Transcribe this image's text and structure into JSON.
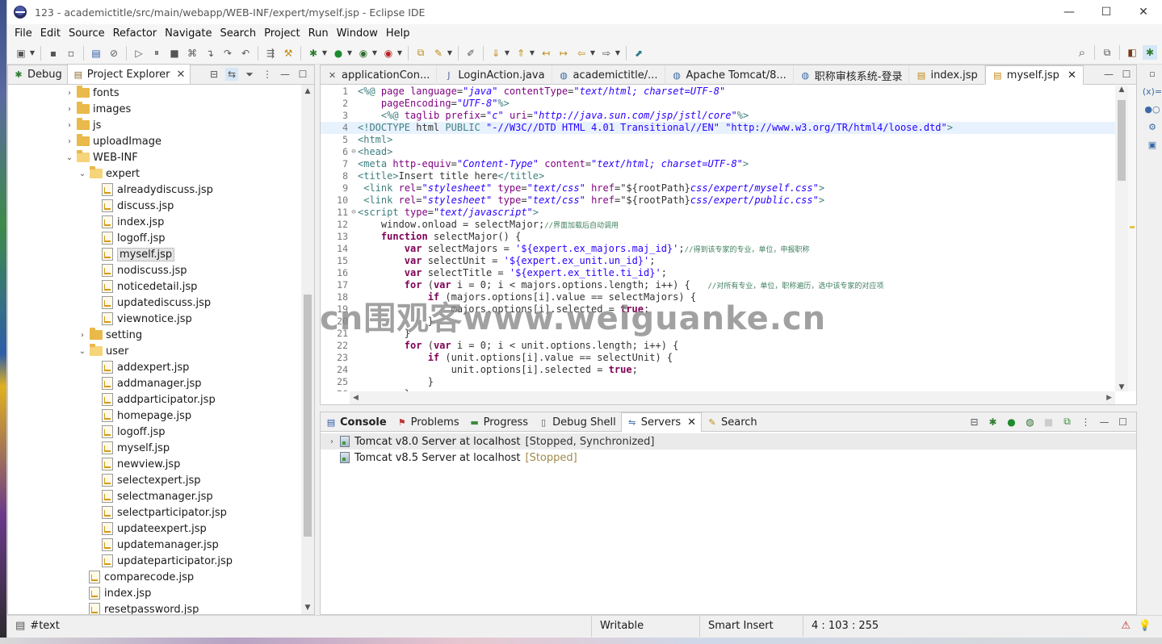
{
  "window": {
    "title": "123 - academictitle/src/main/webapp/WEB-INF/expert/myself.jsp - Eclipse IDE",
    "controls": [
      "—",
      "☐",
      "✕"
    ]
  },
  "menu": [
    "File",
    "Edit",
    "Source",
    "Refactor",
    "Navigate",
    "Search",
    "Project",
    "Run",
    "Window",
    "Help"
  ],
  "left_panel": {
    "tabs": [
      {
        "label": "Debug",
        "icon": "debug-icon"
      },
      {
        "label": "Project Explorer",
        "icon": "project-explorer-icon",
        "close": "✕"
      }
    ],
    "tree": [
      {
        "label": "fonts",
        "type": "folder",
        "depth": 0,
        "chevron": "›"
      },
      {
        "label": "images",
        "type": "folder",
        "depth": 0,
        "chevron": "›"
      },
      {
        "label": "js",
        "type": "folder",
        "depth": 0,
        "chevron": "›"
      },
      {
        "label": "uploadImage",
        "type": "folder",
        "depth": 0,
        "chevron": "›"
      },
      {
        "label": "WEB-INF",
        "type": "folder-open",
        "depth": 0,
        "chevron": "⌄"
      },
      {
        "label": "expert",
        "type": "folder-open",
        "depth": 1,
        "chevron": "⌄"
      },
      {
        "label": "alreadydiscuss.jsp",
        "type": "file",
        "depth": 2
      },
      {
        "label": "discuss.jsp",
        "type": "file",
        "depth": 2
      },
      {
        "label": "index.jsp",
        "type": "file",
        "depth": 2
      },
      {
        "label": "logoff.jsp",
        "type": "file",
        "depth": 2
      },
      {
        "label": "myself.jsp",
        "type": "file",
        "depth": 2,
        "selected": true
      },
      {
        "label": "nodiscuss.jsp",
        "type": "file",
        "depth": 2
      },
      {
        "label": "noticedetail.jsp",
        "type": "file",
        "depth": 2
      },
      {
        "label": "updatediscuss.jsp",
        "type": "file",
        "depth": 2
      },
      {
        "label": "viewnotice.jsp",
        "type": "file",
        "depth": 2
      },
      {
        "label": "setting",
        "type": "folder",
        "depth": 1,
        "chevron": "›"
      },
      {
        "label": "user",
        "type": "folder-open",
        "depth": 1,
        "chevron": "⌄"
      },
      {
        "label": "addexpert.jsp",
        "type": "file",
        "depth": 2
      },
      {
        "label": "addmanager.jsp",
        "type": "file",
        "depth": 2
      },
      {
        "label": "addparticipator.jsp",
        "type": "file",
        "depth": 2
      },
      {
        "label": "homepage.jsp",
        "type": "file",
        "depth": 2
      },
      {
        "label": "logoff.jsp",
        "type": "file",
        "depth": 2
      },
      {
        "label": "myself.jsp",
        "type": "file",
        "depth": 2
      },
      {
        "label": "newview.jsp",
        "type": "file",
        "depth": 2
      },
      {
        "label": "selectexpert.jsp",
        "type": "file",
        "depth": 2
      },
      {
        "label": "selectmanager.jsp",
        "type": "file",
        "depth": 2
      },
      {
        "label": "selectparticipator.jsp",
        "type": "file",
        "depth": 2
      },
      {
        "label": "updateexpert.jsp",
        "type": "file",
        "depth": 2
      },
      {
        "label": "updatemanager.jsp",
        "type": "file",
        "depth": 2
      },
      {
        "label": "updateparticipator.jsp",
        "type": "file",
        "depth": 2
      },
      {
        "label": "comparecode.jsp",
        "type": "file",
        "depth": 1
      },
      {
        "label": "index.jsp",
        "type": "file",
        "depth": 1
      },
      {
        "label": "resetpassword.jsp",
        "type": "file",
        "depth": 1
      }
    ]
  },
  "editor": {
    "tabs": [
      {
        "label": "applicationCon...",
        "icon": "xml-icon"
      },
      {
        "label": "LoginAction.java",
        "icon": "java-icon"
      },
      {
        "label": "academictitle/...",
        "icon": "browser-icon"
      },
      {
        "label": "Apache Tomcat/8...",
        "icon": "browser-icon"
      },
      {
        "label": "职称审核系统-登录",
        "icon": "browser-icon"
      },
      {
        "label": "index.jsp",
        "icon": "jsp-icon"
      },
      {
        "label": "myself.jsp",
        "icon": "jsp-icon",
        "active": true,
        "close": "✕"
      }
    ],
    "lines": [
      {
        "n": "1",
        "fold": "",
        "html": "<span class='t'>&lt;%@</span> <span class='a'>page</span> <span class='a'>language</span>=<span class='s'>\"java\"</span> <span class='a'>contentType</span>=<span class='s'>\"text/html; charset=UTF-8\"</span>"
      },
      {
        "n": "2",
        "fold": "",
        "html": "    <span class='a'>pageEncoding</span>=<span class='s'>\"UTF-8\"</span><span class='t'>%&gt;</span>"
      },
      {
        "n": "3",
        "fold": "",
        "html": "    <span class='t'>&lt;%@</span> <span class='a'>taglib</span> <span class='a'>prefix</span>=<span class='s'>\"c\"</span> <span class='a'>uri</span>=<span class='s'>\"http://java.sun.com/jsp/jstl/core\"</span><span class='t'>%&gt;</span>"
      },
      {
        "n": "4",
        "fold": "",
        "cur": true,
        "html": "<span class='t'>&lt;!DOCTYPE</span> html <span class='t'>PUBLIC</span> <span class='sp'>\"-//W3C//DTD HTML 4.01 Transitional//EN\"</span> <span class='sp'>\"http://www.w3.org/TR/html4/loose.dtd\"</span><span class='t'>&gt;</span>"
      },
      {
        "n": "5",
        "fold": "",
        "html": "<span class='t'>&lt;html&gt;</span>"
      },
      {
        "n": "6",
        "fold": "⊖",
        "html": "<span class='t'>&lt;head&gt;</span>"
      },
      {
        "n": "7",
        "fold": "",
        "html": "<span class='t'>&lt;meta</span> <span class='a'>http-equiv</span>=<span class='s'>\"Content-Type\"</span> <span class='a'>content</span>=<span class='s'>\"text/html; charset=UTF-8\"</span><span class='t'>&gt;</span>"
      },
      {
        "n": "8",
        "fold": "",
        "html": "<span class='t'>&lt;title&gt;</span>Insert title here<span class='t'>&lt;/title&gt;</span>"
      },
      {
        "n": "9",
        "fold": "",
        "html": " <span class='t'>&lt;link</span> <span class='a'>rel</span>=<span class='s'>\"stylesheet\"</span> <span class='a'>type</span>=<span class='s'>\"text/css\"</span> <span class='a'>href</span>=\"${rootPath}<span class='s'>css/expert/myself.css\"</span><span class='t'>&gt;</span>"
      },
      {
        "n": "10",
        "fold": "",
        "html": " <span class='t'>&lt;link</span> <span class='a'>rel</span>=<span class='s'>\"stylesheet\"</span> <span class='a'>type</span>=<span class='s'>\"text/css\"</span> <span class='a'>href</span>=\"${rootPath}<span class='s'>css/expert/public.css\"</span><span class='t'>&gt;</span>"
      },
      {
        "n": "11",
        "fold": "⊖",
        "html": "<span class='t'>&lt;script</span> <span class='a'>type</span>=<span class='s'>\"text/javascript\"</span><span class='t'>&gt;</span>"
      },
      {
        "n": "12",
        "fold": "",
        "html": "    window.onload = selectMajor;<span class='c'>//界面加载后自动调用</span>"
      },
      {
        "n": "13",
        "fold": "",
        "html": "    <span class='k'>function</span> selectMajor() {"
      },
      {
        "n": "14",
        "fold": "",
        "html": "        <span class='k'>var</span> selectMajors = <span class='sp'>'${expert.ex_majors.maj_id}'</span>;<span class='c'>//得到该专家的专业，单位，申报职称</span>"
      },
      {
        "n": "15",
        "fold": "",
        "html": "        <span class='k'>var</span> selectUnit = <span class='sp'>'${expert.ex_unit.un_id}'</span>;"
      },
      {
        "n": "16",
        "fold": "",
        "html": "        <span class='k'>var</span> selectTitle = <span class='sp'>'${expert.ex_title.ti_id}'</span>;"
      },
      {
        "n": "17",
        "fold": "",
        "html": "        <span class='k'>for</span> (<span class='k'>var</span> i = 0; i &lt; majors.options.length; i++) {   <span class='c'>//对所有专业，单位，职称遍历，选中该专家的对应项</span>"
      },
      {
        "n": "18",
        "fold": "",
        "html": "            <span class='k'>if</span> (majors.options[i].value == selectMajors) {"
      },
      {
        "n": "19",
        "fold": "",
        "html": "                majors.options[i].selected = <span class='k'>true</span>;"
      },
      {
        "n": "20",
        "fold": "",
        "html": "            }"
      },
      {
        "n": "21",
        "fold": "",
        "html": "        }"
      },
      {
        "n": "22",
        "fold": "",
        "html": "        <span class='k'>for</span> (<span class='k'>var</span> i = 0; i &lt; unit.options.length; i++) {"
      },
      {
        "n": "23",
        "fold": "",
        "html": "            <span class='k'>if</span> (unit.options[i].value == selectUnit) {"
      },
      {
        "n": "24",
        "fold": "",
        "html": "                unit.options[i].selected = <span class='k'>true</span>;"
      },
      {
        "n": "25",
        "fold": "",
        "html": "            }"
      },
      {
        "n": "26",
        "fold": "",
        "html": "        }"
      }
    ]
  },
  "watermark": "cn围观客www.weiguanke.cn",
  "bottom_panel": {
    "tabs": [
      {
        "label": "Console",
        "icon": "console-icon",
        "bold": true
      },
      {
        "label": "Problems",
        "icon": "problems-icon"
      },
      {
        "label": "Progress",
        "icon": "progress-icon"
      },
      {
        "label": "Debug Shell",
        "icon": "debug-shell-icon"
      },
      {
        "label": "Servers",
        "icon": "servers-icon",
        "active": true,
        "close": "✕"
      },
      {
        "label": "Search",
        "icon": "search-icon"
      }
    ],
    "servers": [
      {
        "name": "Tomcat v8.0 Server at localhost",
        "state": "[Stopped, Synchronized]",
        "selected": true,
        "chevron": "›"
      },
      {
        "name": "Tomcat v8.5 Server at localhost",
        "state": "[Stopped]"
      }
    ]
  },
  "status_bar": {
    "context": "#text",
    "mode": "Writable",
    "insert": "Smart Insert",
    "position": "4 : 103 : 255"
  }
}
